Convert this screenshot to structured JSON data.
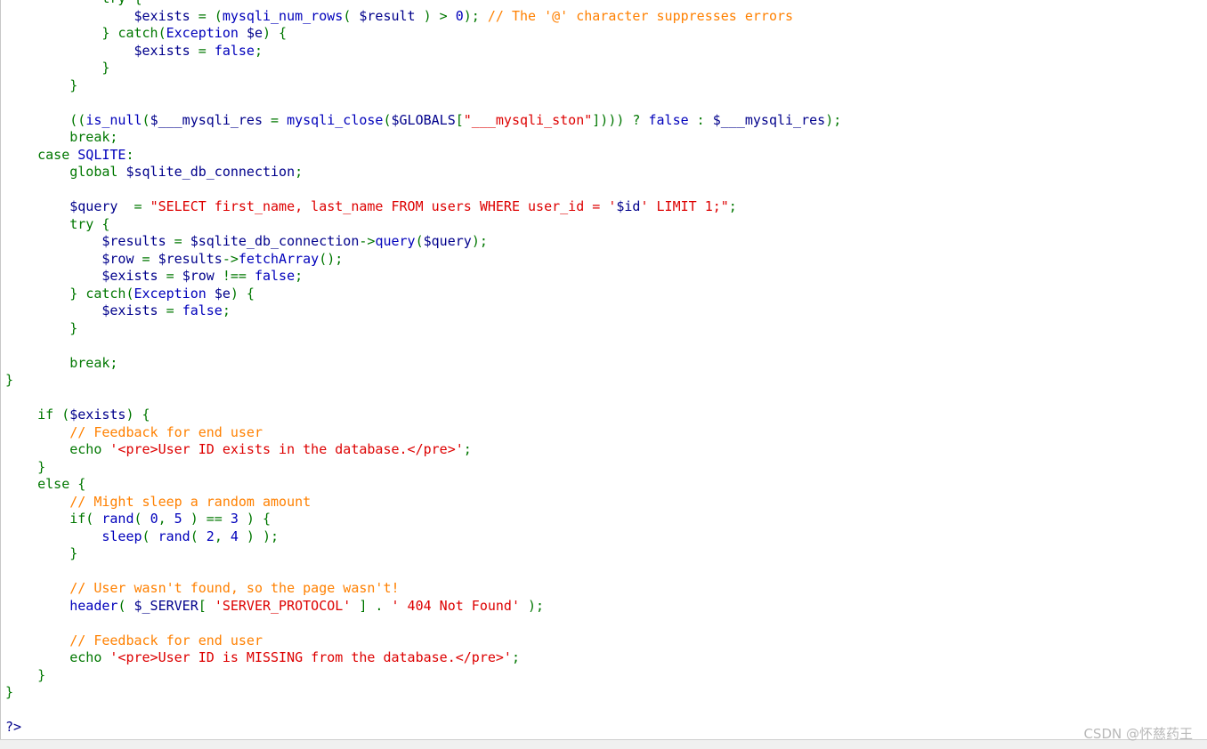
{
  "code_viewer": {
    "lines": [
      [
        {
          "t": "            try {",
          "c": "keyword"
        }
      ],
      [
        {
          "t": "                ",
          "c": "normal"
        },
        {
          "t": "$exists",
          "c": "var"
        },
        {
          "t": " = (",
          "c": "punct"
        },
        {
          "t": "mysqli_num_rows",
          "c": "function"
        },
        {
          "t": "( ",
          "c": "punct"
        },
        {
          "t": "$result",
          "c": "var"
        },
        {
          "t": " ) > ",
          "c": "punct"
        },
        {
          "t": "0",
          "c": "number"
        },
        {
          "t": "); ",
          "c": "punct"
        },
        {
          "t": "// The '@' character suppresses errors",
          "c": "comment"
        }
      ],
      [
        {
          "t": "            } ",
          "c": "punct"
        },
        {
          "t": "catch",
          "c": "keyword"
        },
        {
          "t": "(",
          "c": "punct"
        },
        {
          "t": "Exception ",
          "c": "function"
        },
        {
          "t": "$e",
          "c": "var"
        },
        {
          "t": ") {",
          "c": "punct"
        }
      ],
      [
        {
          "t": "                ",
          "c": "normal"
        },
        {
          "t": "$exists",
          "c": "var"
        },
        {
          "t": " = ",
          "c": "punct"
        },
        {
          "t": "false",
          "c": "function"
        },
        {
          "t": ";",
          "c": "punct"
        }
      ],
      [
        {
          "t": "            }",
          "c": "punct"
        }
      ],
      [
        {
          "t": "        }",
          "c": "punct"
        }
      ],
      [
        {
          "t": "",
          "c": "normal"
        }
      ],
      [
        {
          "t": "        ((",
          "c": "punct"
        },
        {
          "t": "is_null",
          "c": "function"
        },
        {
          "t": "(",
          "c": "punct"
        },
        {
          "t": "$___mysqli_res",
          "c": "var"
        },
        {
          "t": " = ",
          "c": "punct"
        },
        {
          "t": "mysqli_close",
          "c": "function"
        },
        {
          "t": "(",
          "c": "punct"
        },
        {
          "t": "$GLOBALS",
          "c": "var"
        },
        {
          "t": "[",
          "c": "punct"
        },
        {
          "t": "\"___mysqli_ston\"",
          "c": "string"
        },
        {
          "t": "]))) ? ",
          "c": "punct"
        },
        {
          "t": "false",
          "c": "function"
        },
        {
          "t": " : ",
          "c": "punct"
        },
        {
          "t": "$___mysqli_res",
          "c": "var"
        },
        {
          "t": ");",
          "c": "punct"
        }
      ],
      [
        {
          "t": "        break;",
          "c": "keyword"
        }
      ],
      [
        {
          "t": "    case ",
          "c": "keyword"
        },
        {
          "t": "SQLITE",
          "c": "function"
        },
        {
          "t": ":",
          "c": "punct"
        }
      ],
      [
        {
          "t": "        global ",
          "c": "keyword"
        },
        {
          "t": "$sqlite_db_connection",
          "c": "var"
        },
        {
          "t": ";",
          "c": "punct"
        }
      ],
      [
        {
          "t": "",
          "c": "normal"
        }
      ],
      [
        {
          "t": "        ",
          "c": "normal"
        },
        {
          "t": "$query",
          "c": "var"
        },
        {
          "t": "  = ",
          "c": "punct"
        },
        {
          "t": "\"SELECT first_name, last_name FROM users WHERE user_id = '",
          "c": "string"
        },
        {
          "t": "$id",
          "c": "var"
        },
        {
          "t": "' LIMIT 1;\"",
          "c": "string"
        },
        {
          "t": ";",
          "c": "punct"
        }
      ],
      [
        {
          "t": "        try {",
          "c": "keyword"
        }
      ],
      [
        {
          "t": "            ",
          "c": "normal"
        },
        {
          "t": "$results",
          "c": "var"
        },
        {
          "t": " = ",
          "c": "punct"
        },
        {
          "t": "$sqlite_db_connection",
          "c": "var"
        },
        {
          "t": "->",
          "c": "punct"
        },
        {
          "t": "query",
          "c": "function"
        },
        {
          "t": "(",
          "c": "punct"
        },
        {
          "t": "$query",
          "c": "var"
        },
        {
          "t": ");",
          "c": "punct"
        }
      ],
      [
        {
          "t": "            ",
          "c": "normal"
        },
        {
          "t": "$row",
          "c": "var"
        },
        {
          "t": " = ",
          "c": "punct"
        },
        {
          "t": "$results",
          "c": "var"
        },
        {
          "t": "->",
          "c": "punct"
        },
        {
          "t": "fetchArray",
          "c": "function"
        },
        {
          "t": "();",
          "c": "punct"
        }
      ],
      [
        {
          "t": "            ",
          "c": "normal"
        },
        {
          "t": "$exists",
          "c": "var"
        },
        {
          "t": " = ",
          "c": "punct"
        },
        {
          "t": "$row",
          "c": "var"
        },
        {
          "t": " !== ",
          "c": "punct"
        },
        {
          "t": "false",
          "c": "function"
        },
        {
          "t": ";",
          "c": "punct"
        }
      ],
      [
        {
          "t": "        } ",
          "c": "punct"
        },
        {
          "t": "catch",
          "c": "keyword"
        },
        {
          "t": "(",
          "c": "punct"
        },
        {
          "t": "Exception ",
          "c": "function"
        },
        {
          "t": "$e",
          "c": "var"
        },
        {
          "t": ") {",
          "c": "punct"
        }
      ],
      [
        {
          "t": "            ",
          "c": "normal"
        },
        {
          "t": "$exists",
          "c": "var"
        },
        {
          "t": " = ",
          "c": "punct"
        },
        {
          "t": "false",
          "c": "function"
        },
        {
          "t": ";",
          "c": "punct"
        }
      ],
      [
        {
          "t": "        }",
          "c": "punct"
        }
      ],
      [
        {
          "t": "",
          "c": "normal"
        }
      ],
      [
        {
          "t": "        break;",
          "c": "keyword"
        }
      ],
      [
        {
          "t": "}",
          "c": "punct"
        }
      ],
      [
        {
          "t": "",
          "c": "normal"
        }
      ],
      [
        {
          "t": "    if (",
          "c": "keyword"
        },
        {
          "t": "$exists",
          "c": "var"
        },
        {
          "t": ") {",
          "c": "punct"
        }
      ],
      [
        {
          "t": "        ",
          "c": "normal"
        },
        {
          "t": "// Feedback for end user",
          "c": "comment"
        }
      ],
      [
        {
          "t": "        echo ",
          "c": "keyword"
        },
        {
          "t": "'<pre>User ID exists in the database.</pre>'",
          "c": "string"
        },
        {
          "t": ";",
          "c": "punct"
        }
      ],
      [
        {
          "t": "    }",
          "c": "punct"
        }
      ],
      [
        {
          "t": "    else {",
          "c": "keyword"
        }
      ],
      [
        {
          "t": "        ",
          "c": "normal"
        },
        {
          "t": "// Might sleep a random amount",
          "c": "comment"
        }
      ],
      [
        {
          "t": "        if( ",
          "c": "keyword"
        },
        {
          "t": "rand",
          "c": "function"
        },
        {
          "t": "( ",
          "c": "punct"
        },
        {
          "t": "0",
          "c": "number"
        },
        {
          "t": ", ",
          "c": "punct"
        },
        {
          "t": "5",
          "c": "number"
        },
        {
          "t": " ) == ",
          "c": "punct"
        },
        {
          "t": "3",
          "c": "number"
        },
        {
          "t": " ) {",
          "c": "punct"
        }
      ],
      [
        {
          "t": "            ",
          "c": "normal"
        },
        {
          "t": "sleep",
          "c": "function"
        },
        {
          "t": "( ",
          "c": "punct"
        },
        {
          "t": "rand",
          "c": "function"
        },
        {
          "t": "( ",
          "c": "punct"
        },
        {
          "t": "2",
          "c": "number"
        },
        {
          "t": ", ",
          "c": "punct"
        },
        {
          "t": "4",
          "c": "number"
        },
        {
          "t": " ) );",
          "c": "punct"
        }
      ],
      [
        {
          "t": "        }",
          "c": "punct"
        }
      ],
      [
        {
          "t": "",
          "c": "normal"
        }
      ],
      [
        {
          "t": "        ",
          "c": "normal"
        },
        {
          "t": "// User wasn't found, so the page wasn't!",
          "c": "comment"
        }
      ],
      [
        {
          "t": "        ",
          "c": "normal"
        },
        {
          "t": "header",
          "c": "function"
        },
        {
          "t": "( ",
          "c": "punct"
        },
        {
          "t": "$_SERVER",
          "c": "var"
        },
        {
          "t": "[ ",
          "c": "punct"
        },
        {
          "t": "'SERVER_PROTOCOL'",
          "c": "string"
        },
        {
          "t": " ] . ",
          "c": "punct"
        },
        {
          "t": "' 404 Not Found'",
          "c": "string"
        },
        {
          "t": " );",
          "c": "punct"
        }
      ],
      [
        {
          "t": "",
          "c": "normal"
        }
      ],
      [
        {
          "t": "        ",
          "c": "normal"
        },
        {
          "t": "// Feedback for end user",
          "c": "comment"
        }
      ],
      [
        {
          "t": "        echo ",
          "c": "keyword"
        },
        {
          "t": "'<pre>User ID is MISSING from the database.</pre>'",
          "c": "string"
        },
        {
          "t": ";",
          "c": "punct"
        }
      ],
      [
        {
          "t": "    }",
          "c": "punct"
        }
      ],
      [
        {
          "t": "}",
          "c": "punct"
        }
      ],
      [
        {
          "t": "",
          "c": "normal"
        }
      ],
      [
        {
          "t": "?>",
          "c": "var"
        }
      ]
    ]
  },
  "watermark": {
    "text": "CSDN @怀慈药王"
  },
  "colors": {
    "background": "#ffffff",
    "variable": "#00008b",
    "keyword": "#007700",
    "string": "#dd0000",
    "comment": "#ff8000",
    "function": "#0000bb"
  }
}
